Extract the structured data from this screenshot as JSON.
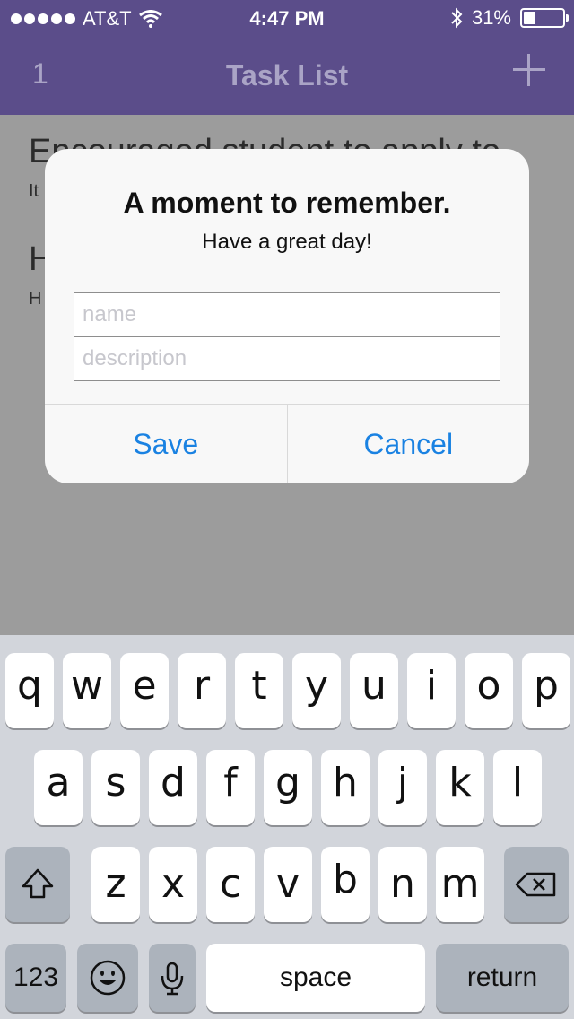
{
  "status": {
    "carrier": "AT&T",
    "time": "4:47 PM",
    "battery": "31%",
    "battery_level": 0.31
  },
  "nav": {
    "left": "1",
    "title": "Task List"
  },
  "list": [
    {
      "title": "Encouraged student to apply to",
      "subtitle": "It"
    },
    {
      "title": "H",
      "subtitle": "H"
    }
  ],
  "alert": {
    "title": "A moment to remember.",
    "message": "Have a great day!",
    "name_placeholder": "name",
    "description_placeholder": "description",
    "save": "Save",
    "cancel": "Cancel"
  },
  "keyboard": {
    "row1": [
      "q",
      "w",
      "e",
      "r",
      "t",
      "y",
      "u",
      "i",
      "o",
      "p"
    ],
    "row2": [
      "a",
      "s",
      "d",
      "f",
      "g",
      "h",
      "j",
      "k",
      "l"
    ],
    "row3": [
      "z",
      "x",
      "c",
      "v",
      "b",
      "n",
      "m"
    ],
    "numbers": "123",
    "space": "space",
    "return": "return"
  }
}
